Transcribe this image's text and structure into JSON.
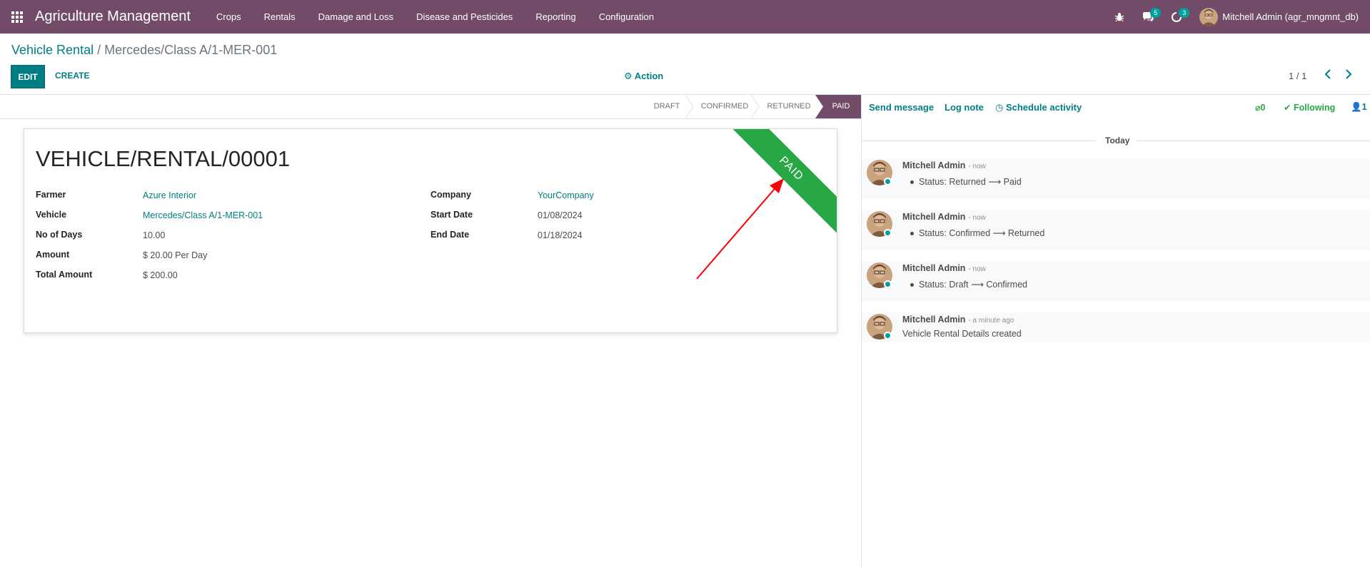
{
  "navbar": {
    "brand": "Agriculture Management",
    "menu": [
      "Crops",
      "Rentals",
      "Damage and Loss",
      "Disease and Pesticides",
      "Reporting",
      "Configuration"
    ],
    "messages_count": "5",
    "activities_count": "3",
    "user": "Mitchell Admin (agr_mngmnt_db)",
    "color": "#714B67"
  },
  "breadcrumb": {
    "parent": "Vehicle Rental",
    "separator": "/",
    "current": "Mercedes/Class A/1-MER-001"
  },
  "control": {
    "edit_label": "EDIT",
    "create_label": "CREATE",
    "action_label": "Action",
    "pager": "1 / 1"
  },
  "statusbar": {
    "stages": [
      "DRAFT",
      "CONFIRMED",
      "RETURNED",
      "PAID"
    ],
    "active": "PAID"
  },
  "record": {
    "title": "VEHICLE/RENTAL/00001",
    "ribbon": "PAID",
    "left_fields": [
      {
        "label": "Farmer",
        "value": "Azure Interior"
      },
      {
        "label": "Vehicle",
        "value": "Mercedes/Class A/1-MER-001"
      },
      {
        "label": "No of Days",
        "value": "10.00"
      },
      {
        "label": "Amount",
        "value": "$ 20.00 Per Day"
      },
      {
        "label": "Total Amount",
        "value": "$ 200.00"
      }
    ],
    "right_fields": [
      {
        "label": "Company",
        "value": "YourCompany"
      },
      {
        "label": "Start Date",
        "value": "01/08/2024"
      },
      {
        "label": "End Date",
        "value": "01/18/2024"
      }
    ]
  },
  "chatter": {
    "send_message": "Send message",
    "log_note": "Log note",
    "schedule_activity": "Schedule activity",
    "attachments": "0",
    "following": "Following",
    "followers": "1",
    "today": "Today",
    "messages": [
      {
        "author": "Mitchell Admin",
        "time": "- now",
        "body": "Status: Returned ⟶ Paid"
      },
      {
        "author": "Mitchell Admin",
        "time": "- now",
        "body": "Status: Confirmed ⟶ Returned"
      },
      {
        "author": "Mitchell Admin",
        "time": "- now",
        "body": "Status: Draft ⟶ Confirmed"
      },
      {
        "author": "Mitchell Admin",
        "time": "- a minute ago",
        "body": "Vehicle Rental Details created"
      }
    ]
  }
}
